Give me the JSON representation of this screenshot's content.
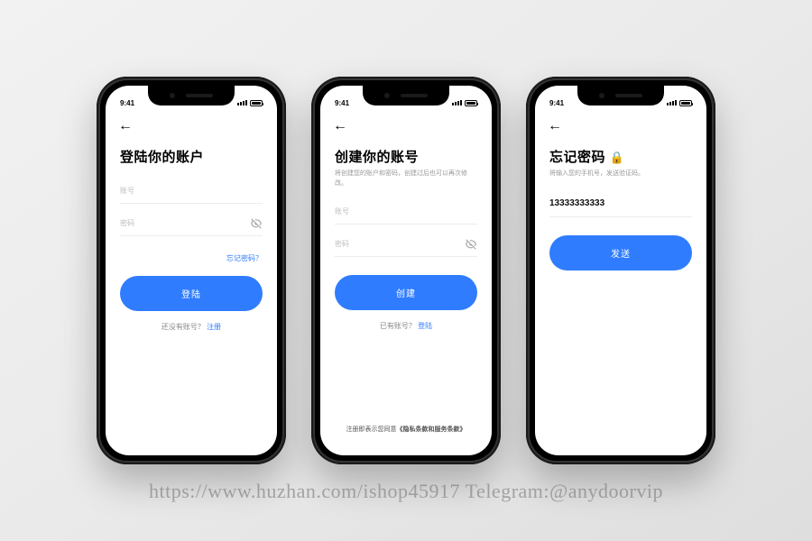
{
  "status": {
    "time": "9:41"
  },
  "login": {
    "title": "登陆你的账户",
    "account_placeholder": "账号",
    "password_placeholder": "密码",
    "forgot": "忘记密码？",
    "button": "登陆",
    "no_account_text": "还没有账号？",
    "register_link": "注册"
  },
  "register": {
    "title": "创建你的账号",
    "subtitle": "将创建您的账户和密码，创建过后也可以再次修改。",
    "account_placeholder": "账号",
    "password_placeholder": "密码",
    "button": "创建",
    "has_account_text": "已有账号？",
    "login_link": "登陆",
    "terms_prefix": "注册即表示您同意",
    "terms_link": "《隐私条款和服务条款》"
  },
  "forgot": {
    "title": "忘记密码",
    "lock": "🔒",
    "subtitle": "将输入您的手机号，发送验证码。",
    "phone_value": "13333333333",
    "button": "发送"
  },
  "watermark": "https://www.huzhan.com/ishop45917  Telegram:@anydoorvip"
}
